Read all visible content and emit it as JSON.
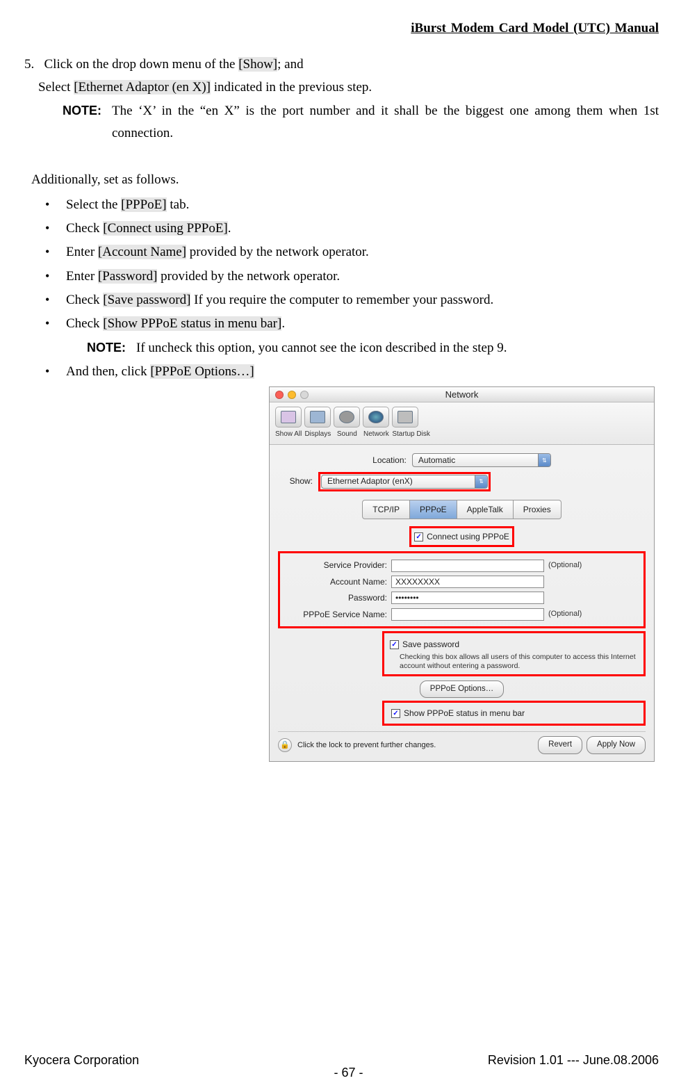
{
  "header": "iBurst Modem Card Model (UTC) Manual",
  "step": {
    "num": "5.",
    "line1a": "Click on the drop down menu of the ",
    "show": "[Show]",
    "line1b": "; and",
    "line2a": "Select ",
    "eth": "[Ethernet Adaptor (en X)]",
    "line2b": " indicated in the previous step."
  },
  "note1": {
    "label": "NOTE:",
    "text": "The ‘X’ in the “en X” is the port number and it shall be the biggest one among them when 1st connection."
  },
  "additional": "Additionally, set as follows.",
  "bullets": [
    {
      "pre": "Select the ",
      "hi": "[PPPoE]",
      "post": " tab."
    },
    {
      "pre": "Check ",
      "hi": "[Connect using PPPoE]",
      "post": "."
    },
    {
      "pre": "Enter ",
      "hi": "[Account Name]",
      "post": " provided by the network operator."
    },
    {
      "pre": "Enter ",
      "hi": "[Password]",
      "post": " provided by the network operator."
    },
    {
      "pre": "Check ",
      "hi": "[Save password]",
      "post": " If you require the computer to remember your password."
    },
    {
      "pre": "Check ",
      "hi": "[Show PPPoE status in menu bar]",
      "post": "."
    }
  ],
  "note2": {
    "label": "NOTE:",
    "text": "If uncheck this option, you cannot see the icon described in the step 9."
  },
  "last_bullet": {
    "pre": "And then, click ",
    "hi": "[PPPoE Options…]",
    "post": ""
  },
  "mac": {
    "title": "Network",
    "toolbar": [
      "Show All",
      "Displays",
      "Sound",
      "Network",
      "Startup Disk"
    ],
    "location_label": "Location:",
    "location_value": "Automatic",
    "show_label": "Show:",
    "show_value": "Ethernet Adaptor (enX)",
    "tabs": [
      "TCP/IP",
      "PPPoE",
      "AppleTalk",
      "Proxies"
    ],
    "connect": "Connect using PPPoE",
    "fields": {
      "sp_label": "Service Provider:",
      "sp_value": "",
      "an_label": "Account Name:",
      "an_value": "XXXXXXXX",
      "pw_label": "Password:",
      "pw_value": "••••••••",
      "psn_label": "PPPoE Service Name:",
      "psn_value": "",
      "optional": "(Optional)"
    },
    "save_label": "Save password",
    "save_hint": "Checking this box allows all users of this computer to access this Internet account without entering a password.",
    "pppoe_options": "PPPoE Options…",
    "show_status": "Show PPPoE status in menu bar",
    "lock_text": "Click the lock to prevent further changes.",
    "revert": "Revert",
    "apply": "Apply Now"
  },
  "footer": {
    "left": "Kyocera Corporation",
    "right": "Revision 1.01 --- June.08.2006",
    "page": "- 67 -"
  }
}
